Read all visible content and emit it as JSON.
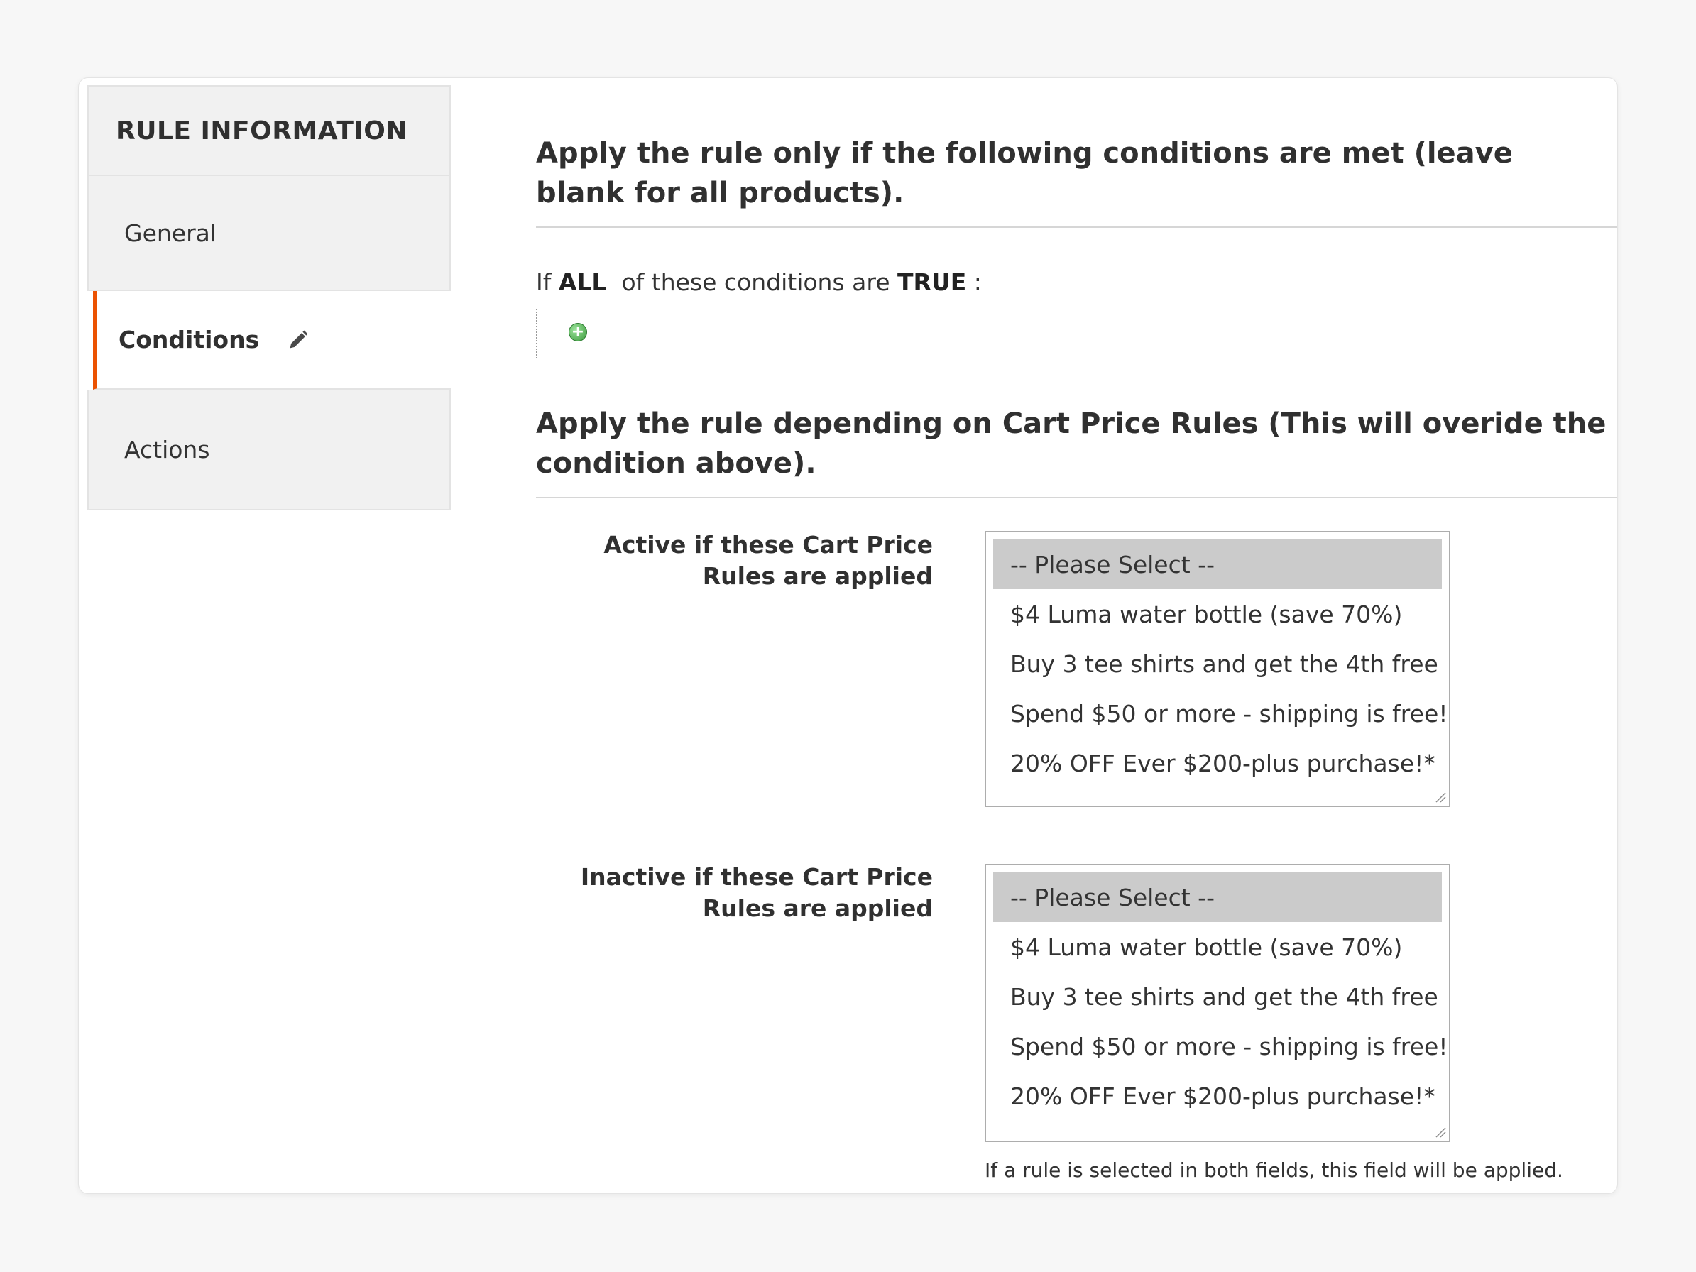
{
  "sidebar": {
    "header": "RULE INFORMATION",
    "items": [
      {
        "label": "General"
      },
      {
        "label": "Conditions"
      },
      {
        "label": "Actions"
      }
    ],
    "active_accent": "#eb5202"
  },
  "conditions": {
    "title": "Apply the rule only if the following conditions are met (leave blank for all products).",
    "line_prefix": "If",
    "aggregator": "ALL",
    "line_middle": "of these conditions are",
    "value": "TRUE",
    "line_suffix": ":",
    "add_icon": "add-circle-icon"
  },
  "cart_rules": {
    "title": "Apply the rule depending on Cart Price Rules (This will overide the condition above).",
    "active_label": "Active if these Cart Price Rules are applied",
    "inactive_label": "Inactive if these Cart Price Rules are applied",
    "options": [
      "-- Please Select --",
      "$4 Luma water bottle (save 70%)",
      "Buy 3 tee shirts and get the 4th free",
      "Spend $50 or more - shipping is free!",
      "20% OFF Ever $200-plus purchase!*"
    ],
    "note": "If a rule is selected in both fields, this field will be applied."
  }
}
